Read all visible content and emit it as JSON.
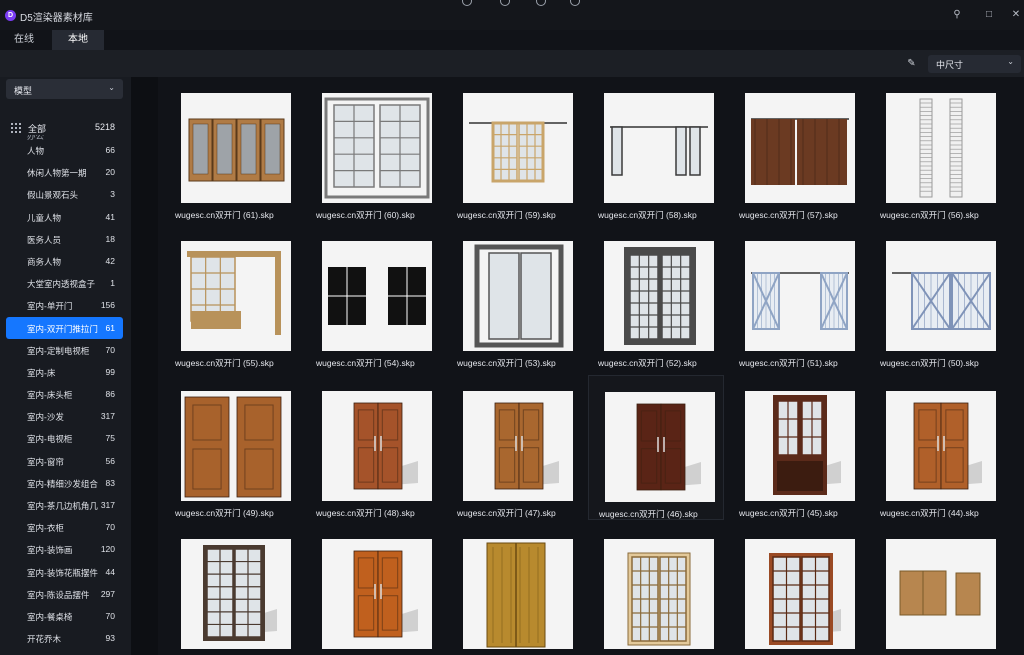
{
  "app": {
    "title": "D5渲染器素材库",
    "logo_letter": "D"
  },
  "tabs": [
    {
      "label": "在线",
      "active": false
    },
    {
      "label": "本地",
      "active": true
    }
  ],
  "toolbar": {
    "size_select": "中尺寸"
  },
  "sidebar": {
    "category_select": "模型",
    "all": {
      "label": "全部",
      "count": "5218"
    },
    "clipped_item": "办公",
    "items": [
      {
        "label": "人物",
        "count": "66"
      },
      {
        "label": "休闲人物第一期",
        "count": "20"
      },
      {
        "label": "假山景观石头",
        "count": "3"
      },
      {
        "label": "儿童人物",
        "count": "41"
      },
      {
        "label": "医务人员",
        "count": "18"
      },
      {
        "label": "商务人物",
        "count": "42"
      },
      {
        "label": "大堂室内透视盒子",
        "count": "1"
      },
      {
        "label": "室内-单开门",
        "count": "156"
      },
      {
        "label": "室内-双开门推拉门",
        "count": "61",
        "active": true
      },
      {
        "label": "室内-定制电视柜",
        "count": "70"
      },
      {
        "label": "室内-床",
        "count": "99"
      },
      {
        "label": "室内-床头柜",
        "count": "86"
      },
      {
        "label": "室内-沙发",
        "count": "317"
      },
      {
        "label": "室内-电视柜",
        "count": "75"
      },
      {
        "label": "室内-窗帘",
        "count": "56"
      },
      {
        "label": "室内-精细沙发组合",
        "count": "83"
      },
      {
        "label": "室内-茶几边机角几",
        "count": "317"
      },
      {
        "label": "室内-衣柜",
        "count": "70"
      },
      {
        "label": "室内-装饰画",
        "count": "120"
      },
      {
        "label": "室内-装饰花瓶摆件",
        "count": "44"
      },
      {
        "label": "室内-陈设品摆件",
        "count": "297"
      },
      {
        "label": "室内-餐桌椅",
        "count": "70"
      },
      {
        "label": "开花乔木",
        "count": "93"
      }
    ]
  },
  "assets": [
    {
      "name": "wugesc.cn双开门 (61).skp",
      "style": "glass4",
      "color": "#b07b45"
    },
    {
      "name": "wugesc.cn双开门 (60).skp",
      "style": "sliding",
      "color": "#7a7a7a"
    },
    {
      "name": "wugesc.cn双开门 (59).skp",
      "style": "barn-grid",
      "color": "#c9a56a"
    },
    {
      "name": "wugesc.cn双开门 (58).skp",
      "style": "bifold",
      "color": "#3a3a3a"
    },
    {
      "name": "wugesc.cn双开门 (57).skp",
      "style": "barn-plank",
      "color": "#6b3a22"
    },
    {
      "name": "wugesc.cn双开门 (56).skp",
      "style": "louver",
      "color": "#9a9a9a"
    },
    {
      "name": "wugesc.cn双开门 (55).skp",
      "style": "partition",
      "color": "#b8925a"
    },
    {
      "name": "wugesc.cn双开门 (54).skp",
      "style": "black",
      "color": "#111111"
    },
    {
      "name": "wugesc.cn双开门 (53).skp",
      "style": "frame-glass",
      "color": "#555555"
    },
    {
      "name": "wugesc.cn双开门 (52).skp",
      "style": "french",
      "color": "#4a4a4a"
    },
    {
      "name": "wugesc.cn双开门 (51).skp",
      "style": "barn-x",
      "color": "#8fa4c4"
    },
    {
      "name": "wugesc.cn双开门 (50).skp",
      "style": "barn-x-wide",
      "color": "#7f93b8"
    },
    {
      "name": "wugesc.cn双开门 (49).skp",
      "style": "wood-open",
      "color": "#a8622c"
    },
    {
      "name": "wugesc.cn双开门 (48).skp",
      "style": "wood-panel",
      "color": "#a5532a"
    },
    {
      "name": "wugesc.cn双开门 (47).skp",
      "style": "wood-carved",
      "color": "#a9672f"
    },
    {
      "name": "wugesc.cn双开门 (46).skp",
      "style": "dark-wood",
      "color": "#5a2416"
    },
    {
      "name": "wugesc.cn双开门 (45).skp",
      "style": "gothic",
      "color": "#5b2a1a"
    },
    {
      "name": "wugesc.cn双开门 (44).skp",
      "style": "wood-panel-wide",
      "color": "#b0602a"
    },
    {
      "name": "",
      "style": "glass-dark-frame",
      "color": "#4a3a30"
    },
    {
      "name": "",
      "style": "orange-door",
      "color": "#c0601e"
    },
    {
      "name": "",
      "style": "tall-golden",
      "color": "#b88a2e"
    },
    {
      "name": "",
      "style": "light-grid",
      "color": "#e3c99a"
    },
    {
      "name": "",
      "style": "shelf-door",
      "color": "#9a4a24"
    },
    {
      "name": "",
      "style": "small-pair",
      "color": "#b7864f"
    }
  ]
}
